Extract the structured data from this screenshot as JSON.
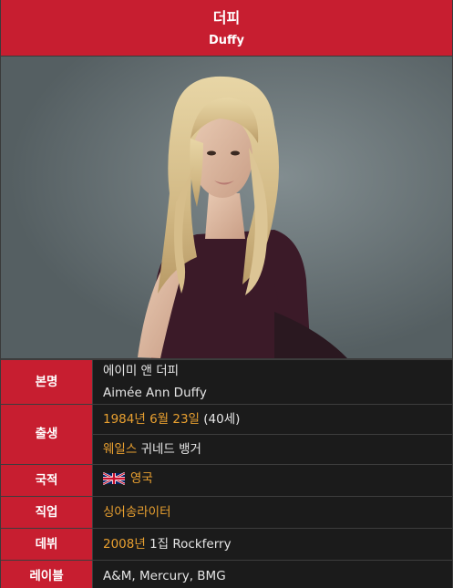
{
  "header": {
    "name_ko": "더피",
    "name_en": "Duffy"
  },
  "colors": {
    "accent": "#c71e30",
    "link": "#e9a030",
    "background": "#1b1b1b",
    "text": "#e6e6e6"
  },
  "rows": {
    "real_name": {
      "label": "본명",
      "line1": "에이미 앤 더피",
      "line2": "Aimée Ann Duffy"
    },
    "birth": {
      "label": "출생",
      "date_link": "1984년 6월 23일",
      "age": "(40세)",
      "place_link": "웨일스",
      "place_rest": "귀네드 뱅거"
    },
    "nationality": {
      "label": "국적",
      "flag_icon": "uk-flag-icon",
      "value_link": "영국"
    },
    "occupation": {
      "label": "직업",
      "value_link": "싱어송라이터"
    },
    "debut": {
      "label": "데뷔",
      "year_link": "2008년",
      "rest": "1집 Rockferry"
    },
    "label_row": {
      "label": "레이블",
      "value": "A&M, Mercury, BMG"
    }
  }
}
